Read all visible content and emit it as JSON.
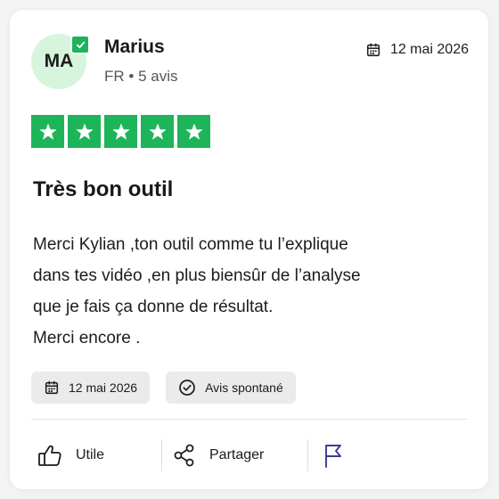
{
  "review": {
    "avatar_initials": "MA",
    "author_name": "Marius",
    "author_country": "FR",
    "meta_separator": "•",
    "author_review_count": "5 avis",
    "date": "12 mai 2026",
    "rating": 5,
    "rating_max": 5,
    "title": "Très bon outil",
    "body_lines": [
      "Merci Kylian ,ton outil comme tu l’explique",
      "dans tes vidéo ,en plus biensûr de l’analyse",
      "que je fais ça donne de résultat.",
      "Merci encore ."
    ],
    "chips": {
      "date": "12 mai 2026",
      "spontaneous": "Avis spontané"
    },
    "actions": {
      "useful": "Utile",
      "share": "Partager"
    }
  },
  "colors": {
    "star_green": "#1db45a",
    "avatar_bg": "#d6f5dc",
    "flag_blue": "#3c3c8f"
  },
  "icons": {
    "verified": "check-icon",
    "date": "calendar-icon",
    "spontaneous": "check-circle-icon",
    "useful": "thumbs-up-icon",
    "share": "share-icon",
    "report": "flag-icon"
  }
}
